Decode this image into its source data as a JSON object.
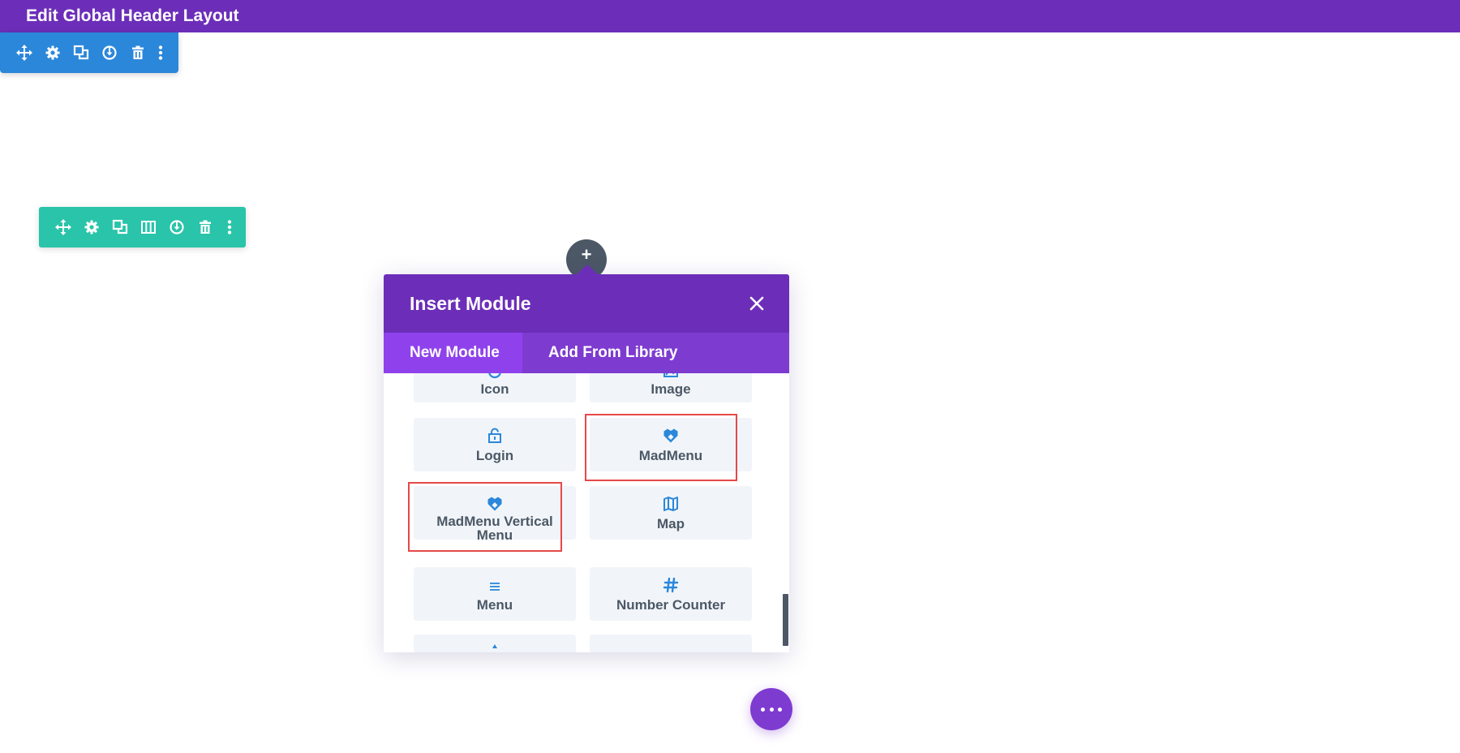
{
  "header": {
    "title": "Edit Global Header Layout"
  },
  "section_toolbar": {
    "color": "#2b87da",
    "icons": [
      "move-icon",
      "gear-icon",
      "duplicate-icon",
      "save-icon",
      "trash-icon",
      "more-icon"
    ]
  },
  "row_toolbar": {
    "color": "#29c4a9",
    "icons": [
      "move-icon",
      "gear-icon",
      "duplicate-icon",
      "columns-icon",
      "save-icon",
      "trash-icon",
      "more-icon"
    ]
  },
  "plus_button": {
    "glyph": "+"
  },
  "modal": {
    "title": "Insert Module",
    "close_icon": "close-icon",
    "tabs": [
      {
        "label": "New Module",
        "active": true
      },
      {
        "label": "Add From Library",
        "active": false
      }
    ],
    "modules": [
      {
        "label": "Icon",
        "icon": "circle-icon"
      },
      {
        "label": "Image",
        "icon": "image-icon"
      },
      {
        "label": "Login",
        "icon": "unlock-icon"
      },
      {
        "label": "MadMenu",
        "icon": "madmenu-icon",
        "highlighted": true
      },
      {
        "label": "MadMenu Vertical Menu",
        "icon": "madmenu-icon",
        "highlighted": true
      },
      {
        "label": "Map",
        "icon": "map-icon"
      },
      {
        "label": "Menu",
        "icon": "menu-icon"
      },
      {
        "label": "Number Counter",
        "icon": "hash-icon"
      }
    ]
  },
  "colors": {
    "purple": "#6c2eb9",
    "tab_active": "#8f42ec",
    "highlight": "#e64848",
    "module_icon": "#2b87da"
  },
  "more_button": {
    "icon": "dots-icon"
  }
}
